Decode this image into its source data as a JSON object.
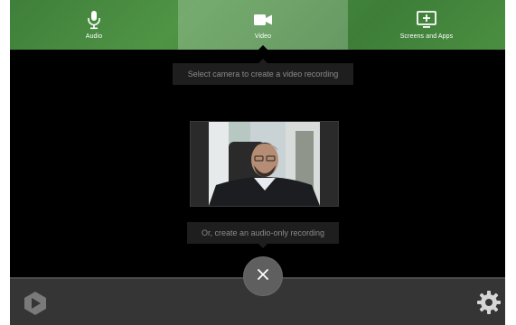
{
  "tabs": [
    {
      "label": "Audio",
      "icon": "microphone-icon"
    },
    {
      "label": "Video",
      "icon": "video-camera-icon",
      "selected": true
    },
    {
      "label": "Screens and Apps",
      "icon": "screen-add-icon"
    }
  ],
  "main": {
    "camera_hint": "Select camera to create a video recording",
    "audio_hint": "Or, create an audio-only recording"
  },
  "bottombar": {
    "logo_icon": "app-logo-icon",
    "settings_icon": "gear-icon",
    "close_icon": "close-icon"
  },
  "colors": {
    "accent_green": "#4f9445",
    "background": "#000000",
    "bottombar": "#353535",
    "tooltip": "#1e1e1e"
  }
}
